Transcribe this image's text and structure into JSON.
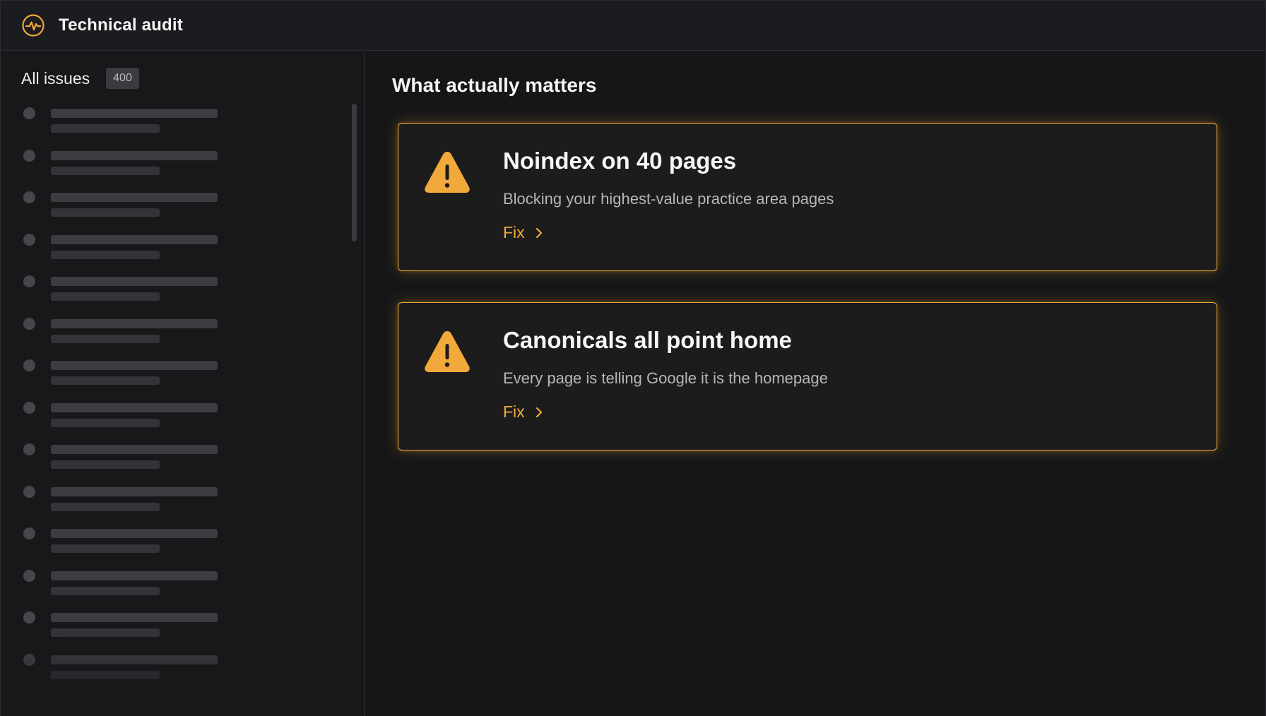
{
  "header": {
    "title": "Technical audit",
    "icon": "activity-pulse-icon",
    "accent": "#f2a93b"
  },
  "sidebar": {
    "title": "All issues",
    "count": "400",
    "placeholder_rows": 14
  },
  "main": {
    "title": "What actually matters",
    "cards": [
      {
        "title": "Noindex on 40 pages",
        "description": "Blocking your highest-value practice area pages",
        "action_label": "Fix",
        "icon": "warning-triangle-icon"
      },
      {
        "title": "Canonicals all point home",
        "description": "Every page is telling Google it is the homepage",
        "action_label": "Fix",
        "icon": "warning-triangle-icon"
      }
    ]
  }
}
